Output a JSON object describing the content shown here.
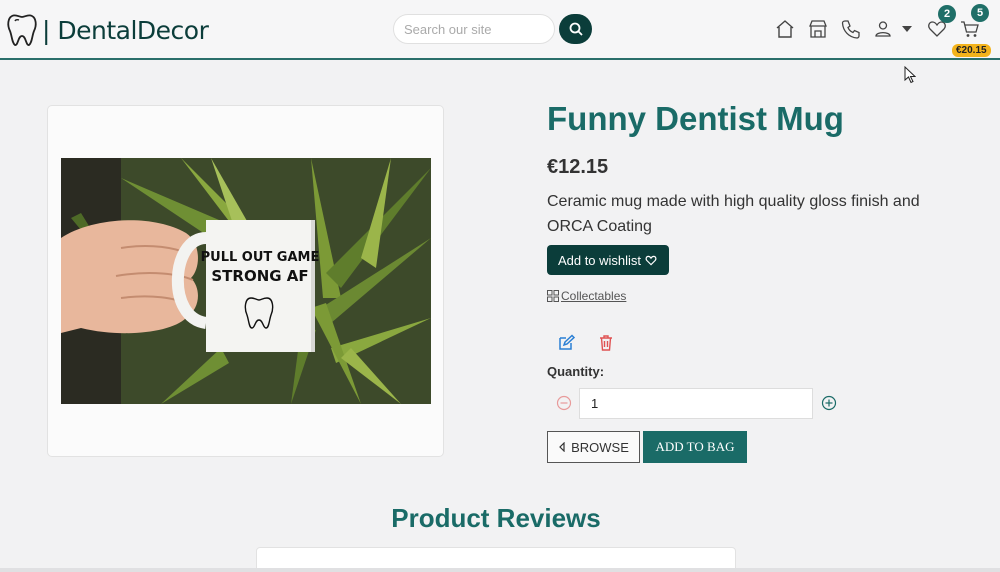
{
  "header": {
    "brand": "| DentalDecor",
    "search_placeholder": "Search our site",
    "wishlist_count": "2",
    "cart_count": "5",
    "cart_total": "€20.15",
    "icons": [
      "tooth-icon",
      "search-icon",
      "home-icon",
      "store-icon",
      "phone-icon",
      "user-icon",
      "chevron-down-icon",
      "heart-icon",
      "cart-icon"
    ]
  },
  "product": {
    "image_alt": "PULL OUT GAME STRONG AF",
    "mug_text_line1": "PULL OUT GAME",
    "mug_text_line2": "STRONG AF",
    "title": "Funny Dentist Mug",
    "price": "€12.15",
    "description": "Ceramic mug made with high quality gloss finish and ORCA Coating",
    "wishlist_label": "Add to wishlist",
    "category": "Collectables",
    "quantity_label": "Quantity:",
    "quantity_value": "1",
    "browse_label": "BROWSE",
    "add_to_bag_label": "ADD TO BAG"
  },
  "reviews": {
    "title": "Product Reviews"
  },
  "colors": {
    "brand_dark": "#0b3d3a",
    "brand_teal": "#1a6b67",
    "badge_yellow": "#f3b31c",
    "danger": "#e05252",
    "edit_blue": "#2a7fd4"
  }
}
